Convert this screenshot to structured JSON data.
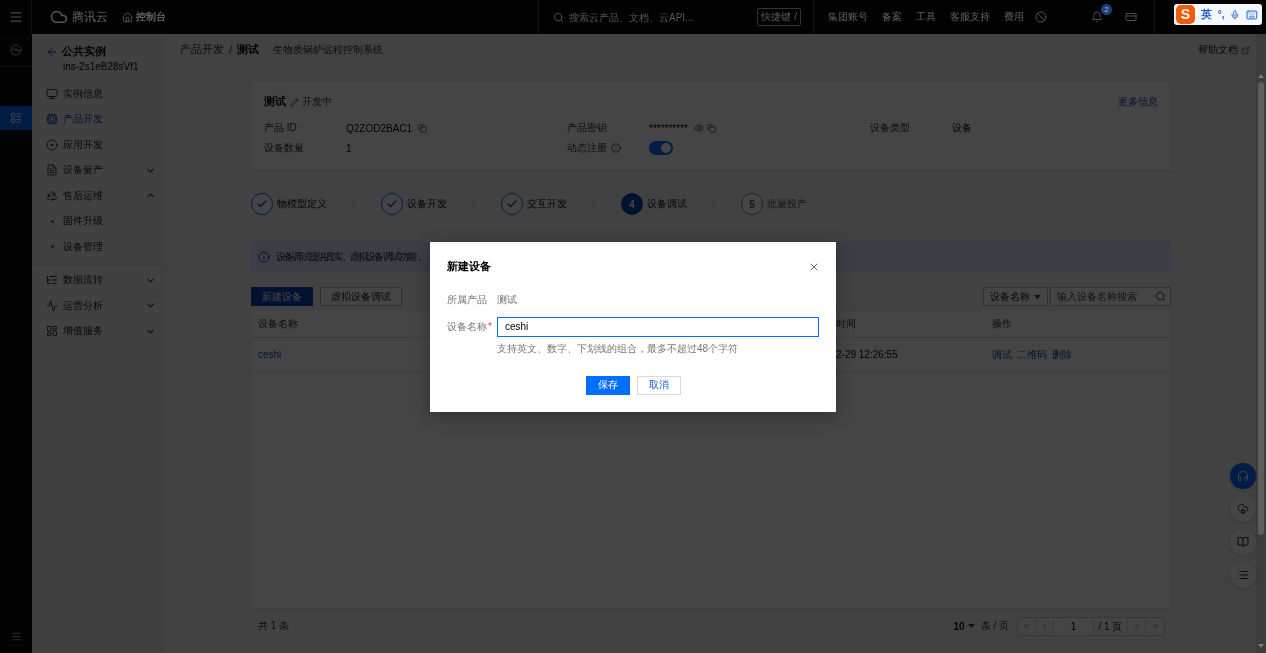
{
  "top_bar": {
    "brand": "腾讯云",
    "console_link": "控制台",
    "search": {
      "placeholder": "搜索云产品、文档、云API..."
    },
    "shortcut": "快捷键 /",
    "links": [
      "集团账号",
      "备案",
      "工具",
      "客服支持",
      "费用"
    ],
    "notification_count": "2"
  },
  "ime_toolbar": {
    "logo": "S",
    "language": "英",
    "punctuation": "°,"
  },
  "rail": {
    "items": [
      {
        "selected": false
      },
      {
        "selected": true
      }
    ]
  },
  "sidebar": {
    "back_label": "公共实例",
    "instance_id": "ins-2s1eB28sVf1",
    "items": [
      {
        "label": "实例信息",
        "selected": false
      },
      {
        "label": "产品开发",
        "selected": true
      },
      {
        "label": "应用开发",
        "selected": false
      },
      {
        "label": "设备量产",
        "selected": false,
        "expanded": false
      },
      {
        "label": "售后运维",
        "selected": false,
        "expanded": true,
        "children": [
          {
            "label": "固件升级",
            "selected": false
          },
          {
            "label": "设备管理",
            "selected": false
          }
        ]
      },
      {
        "label": "数据流转",
        "selected": false,
        "expanded": false
      },
      {
        "label": "运营分析",
        "selected": false,
        "expanded": false
      },
      {
        "label": "增值服务",
        "selected": false,
        "expanded": false
      }
    ]
  },
  "breadcrumb": {
    "items": [
      "产品开发",
      "测试"
    ],
    "separator": "/",
    "subtitle": "生物质锅炉远程控制系统",
    "help_link": "帮助文档"
  },
  "product_card": {
    "name": "测试",
    "status": "开发中",
    "more_link": "更多信息",
    "fields": [
      {
        "kind": "copy",
        "label": "产品 ID",
        "value": "Q2ZOD2BAC1"
      },
      {
        "kind": "secret",
        "label": "产品密钥",
        "value": "**********"
      },
      {
        "kind": "text",
        "label": "设备类型",
        "value": "设备"
      },
      {
        "kind": "text",
        "label": "设备数量",
        "value": "1"
      },
      {
        "kind": "toggle",
        "label": "动态注册",
        "info_icon": true,
        "on": true
      }
    ]
  },
  "steps": [
    {
      "label": "物模型定义",
      "done": true,
      "selected": false
    },
    {
      "label": "设备开发",
      "done": true,
      "selected": false
    },
    {
      "label": "交互开发",
      "done": true,
      "selected": false
    },
    {
      "label": "设备调试",
      "done": false,
      "selected": true,
      "number": "4"
    },
    {
      "label": "批量投产",
      "done": false,
      "selected": false,
      "number": "5"
    }
  ],
  "info_banner": {
    "text": "设备调试提供真实、虚拟设备调试功能，"
  },
  "toolbar": {
    "buttons": [
      {
        "label": "新建设备",
        "kind": "primary"
      },
      {
        "label": "虚拟设备调试",
        "kind": "default"
      }
    ],
    "filter_select": "设备名称",
    "search": {
      "placeholder": "输入设备名称搜索"
    }
  },
  "table": {
    "columns": [
      "设备名称",
      "时间",
      "操作"
    ],
    "rows": [
      {
        "device_name": "ceshi",
        "column_2": "2-29 12:26:55",
        "actions": [
          "调试",
          "二维码",
          "删除"
        ]
      }
    ]
  },
  "pagination": {
    "total": "共 1 条",
    "page_size": "10",
    "page_size_unit": "条 / 页",
    "page": "1",
    "page_count": "/ 1 页"
  },
  "dialog": {
    "title": "新建设备",
    "fields": [
      {
        "kind": "text",
        "label": "所属产品",
        "value": "测试"
      },
      {
        "kind": "input",
        "label": "设备名称",
        "required_mark": "*",
        "value": "ceshi",
        "focused": true,
        "hint": "支持英文、数字、下划线的组合，最多不超过48个字符"
      }
    ],
    "buttons": [
      {
        "label": "保存",
        "kind": "primary"
      },
      {
        "label": "取消",
        "kind": "default"
      }
    ]
  }
}
